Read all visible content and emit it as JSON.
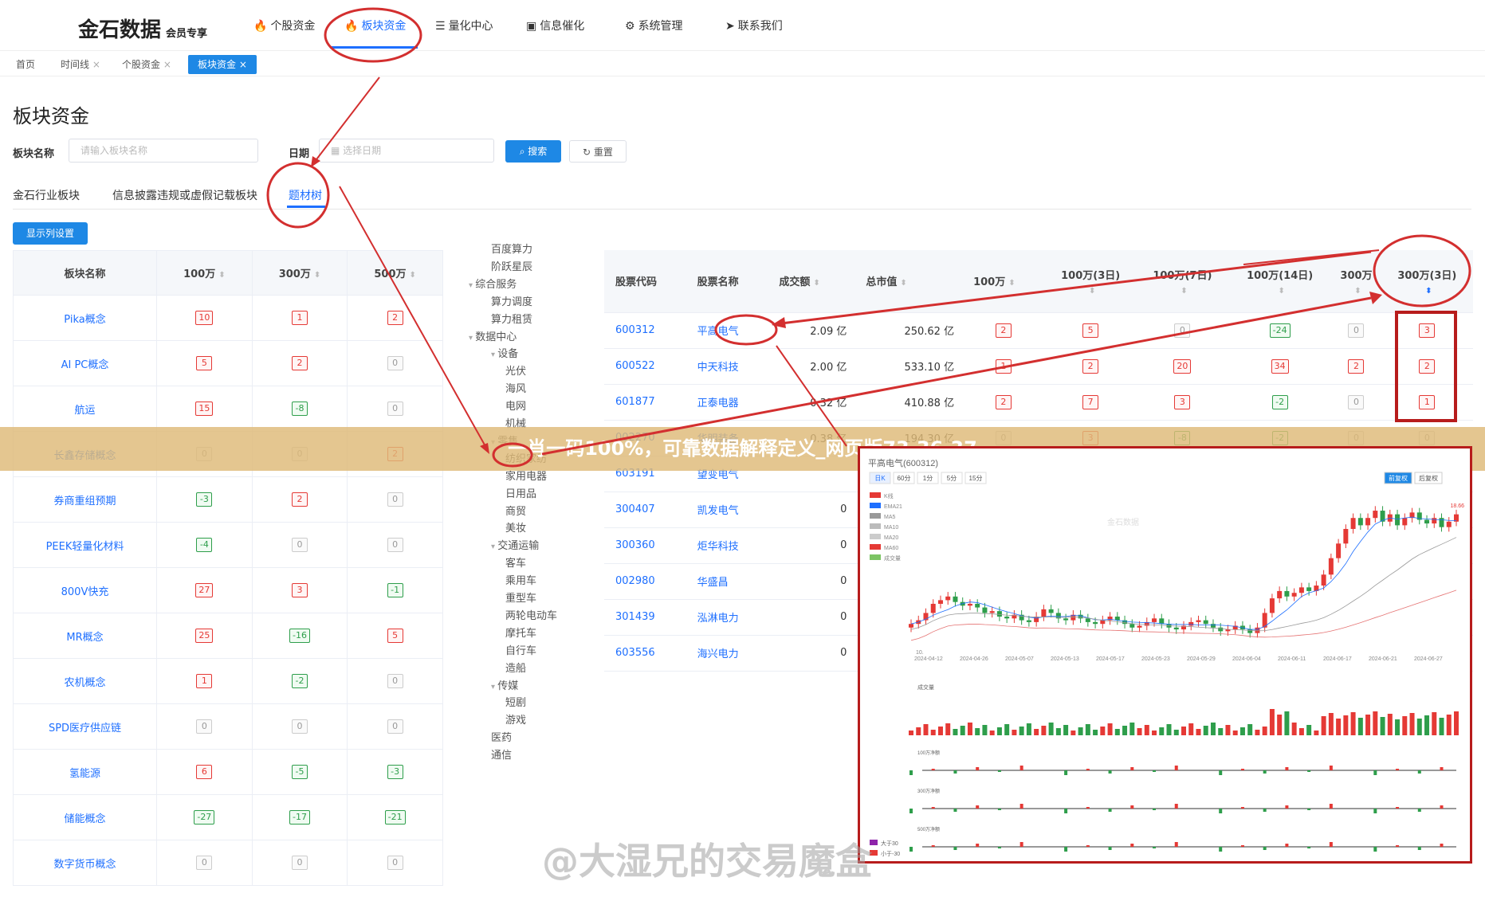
{
  "header": {
    "logo": "金石数据",
    "logo_sub": "会员专享",
    "nav": [
      {
        "icon": "fire-icon",
        "glyph": "🔥",
        "label": "个股资金"
      },
      {
        "icon": "fire-icon",
        "glyph": "🔥",
        "label": "板块资金"
      },
      {
        "icon": "list-icon",
        "glyph": "☰",
        "label": "量化中心"
      },
      {
        "icon": "window-icon",
        "glyph": "▣",
        "label": "信息催化"
      },
      {
        "icon": "gear-icon",
        "glyph": "⚙",
        "label": "系统管理"
      },
      {
        "icon": "send-icon",
        "glyph": "➤",
        "label": "联系我们"
      }
    ]
  },
  "tabs": [
    "首页",
    "时间线",
    "个股资金",
    "板块资金"
  ],
  "page_title": "板块资金",
  "filters": {
    "name_label": "板块名称",
    "name_placeholder": "请输入板块名称",
    "date_label": "日期",
    "date_placeholder": "选择日期",
    "search": "搜索",
    "reset": "重置"
  },
  "subtabs": [
    "金石行业板块",
    "信息披露违规或虚假记载板块",
    "题材树"
  ],
  "column_settings": "显示列设置",
  "left_table": {
    "headers": [
      "板块名称",
      "100万",
      "300万",
      "500万"
    ],
    "rows": [
      [
        "Pika概念",
        "10",
        "1",
        "2"
      ],
      [
        "AI PC概念",
        "5",
        "2",
        "0"
      ],
      [
        "航运",
        "15",
        "-8",
        "0"
      ],
      [
        "长鑫存储概念",
        "0",
        "0",
        "2"
      ],
      [
        "券商重组预期",
        "-3",
        "2",
        "0"
      ],
      [
        "PEEK轻量化材料",
        "-4",
        "0",
        "0"
      ],
      [
        "800V快充",
        "27",
        "3",
        "-1"
      ],
      [
        "MR概念",
        "25",
        "-16",
        "5"
      ],
      [
        "农机概念",
        "1",
        "-2",
        "0"
      ],
      [
        "SPD医疗供应链",
        "0",
        "0",
        "0"
      ],
      [
        "氢能源",
        "6",
        "-5",
        "-3"
      ],
      [
        "储能概念",
        "-27",
        "-17",
        "-21"
      ],
      [
        "数字货币概念",
        "0",
        "0",
        "0"
      ]
    ]
  },
  "tree": [
    {
      "label": "百度算力",
      "lvl": 2
    },
    {
      "label": "阶跃星辰",
      "lvl": 2
    },
    {
      "label": "综合服务",
      "lvl": 1
    },
    {
      "label": "算力调度",
      "lvl": 2
    },
    {
      "label": "算力租赁",
      "lvl": 2
    },
    {
      "label": "数据中心",
      "lvl": 1
    },
    {
      "label": "设备",
      "lvl": 2
    },
    {
      "label": "光伏",
      "lvl": 3
    },
    {
      "label": "海风",
      "lvl": 3
    },
    {
      "label": "电网",
      "lvl": 3
    },
    {
      "label": "机械",
      "lvl": 3
    },
    {
      "label": "零售",
      "lvl": 2
    },
    {
      "label": "纺织家纺",
      "lvl": 3
    },
    {
      "label": "家用电器",
      "lvl": 3
    },
    {
      "label": "日用品",
      "lvl": 3
    },
    {
      "label": "商贸",
      "lvl": 3
    },
    {
      "label": "美妆",
      "lvl": 3
    },
    {
      "label": "交通运输",
      "lvl": 2
    },
    {
      "label": "客车",
      "lvl": 3
    },
    {
      "label": "乘用车",
      "lvl": 3
    },
    {
      "label": "重型车",
      "lvl": 3
    },
    {
      "label": "两轮电动车",
      "lvl": 3
    },
    {
      "label": "摩托车",
      "lvl": 3
    },
    {
      "label": "自行车",
      "lvl": 3
    },
    {
      "label": "造船",
      "lvl": 3
    },
    {
      "label": "传媒",
      "lvl": 2
    },
    {
      "label": "短剧",
      "lvl": 3
    },
    {
      "label": "游戏",
      "lvl": 3
    },
    {
      "label": "医药",
      "lvl": 2
    },
    {
      "label": "通信",
      "lvl": 2
    }
  ],
  "right_table": {
    "headers": [
      "股票代码",
      "股票名称",
      "成交额",
      "总市值",
      "100万",
      "100万(3日)",
      "100万(7日)",
      "100万(14日)",
      "300万",
      "300万(3日)"
    ],
    "rows": [
      {
        "code": "600312",
        "name": "平高电气",
        "amount": "2.09 亿",
        "cap": "250.62 亿",
        "v": [
          "2",
          "5",
          "0",
          "-24",
          "0",
          "3"
        ]
      },
      {
        "code": "600522",
        "name": "中天科技",
        "amount": "2.00 亿",
        "cap": "533.10 亿",
        "v": [
          "1",
          "2",
          "20",
          "34",
          "2",
          "2"
        ]
      },
      {
        "code": "601877",
        "name": "正泰电器",
        "amount": "0.32 亿",
        "cap": "410.88 亿",
        "v": [
          "2",
          "7",
          "3",
          "-2",
          "0",
          "1"
        ]
      },
      {
        "code": "002270",
        "name": "华明装备",
        "amount": "0.38 亿",
        "cap": "194.30 亿",
        "v": [
          "0",
          "3",
          "-8",
          "-2",
          "0",
          "0"
        ]
      },
      {
        "code": "603191",
        "name": "望变电气",
        "amount": "",
        "cap": "",
        "v": []
      },
      {
        "code": "300407",
        "name": "凯发电气",
        "amount": "0",
        "cap": "",
        "v": []
      },
      {
        "code": "300360",
        "name": "炬华科技",
        "amount": "0",
        "cap": "",
        "v": []
      },
      {
        "code": "002980",
        "name": "华盛昌",
        "amount": "0",
        "cap": "",
        "v": []
      },
      {
        "code": "301439",
        "name": "泓淋电力",
        "amount": "0",
        "cap": "",
        "v": []
      },
      {
        "code": "603556",
        "name": "海兴电力",
        "amount": "0",
        "cap": "",
        "v": []
      }
    ]
  },
  "chart_popup": {
    "title": "平高电气(600312)",
    "periods": [
      "日K",
      "60分",
      "1分",
      "5分",
      "15分"
    ],
    "buttons": [
      "前复权",
      "后复权"
    ],
    "legend": [
      "K线",
      "EMA21",
      "MA5",
      "MA10",
      "MA20",
      "MA60",
      "成交量"
    ],
    "watermark": "金石数据",
    "y_top": "18.66",
    "y_bottom": "10.",
    "dates": [
      "2024-04-12",
      "2024-04-26",
      "2024-05-07",
      "2024-05-13",
      "2024-05-17",
      "2024-05-23",
      "2024-05-29",
      "2024-06-04",
      "2024-06-11",
      "2024-06-17",
      "2024-06-21",
      "2024-06-27"
    ],
    "volume_label": "成交量",
    "sub_labels": [
      "100万净额",
      "300万净额",
      "500万净额"
    ],
    "legend_bottom": [
      "大于30",
      "小于-30"
    ]
  },
  "banner": "一肖一码100%，可靠数据解释定义_网页版73.36.37",
  "watermark": "@大湿兄的交易魔盒",
  "colors": {
    "accent": "#1e6fff",
    "up": "#e53935",
    "down": "#2e9e4b",
    "annotation": "#d32f2f"
  }
}
